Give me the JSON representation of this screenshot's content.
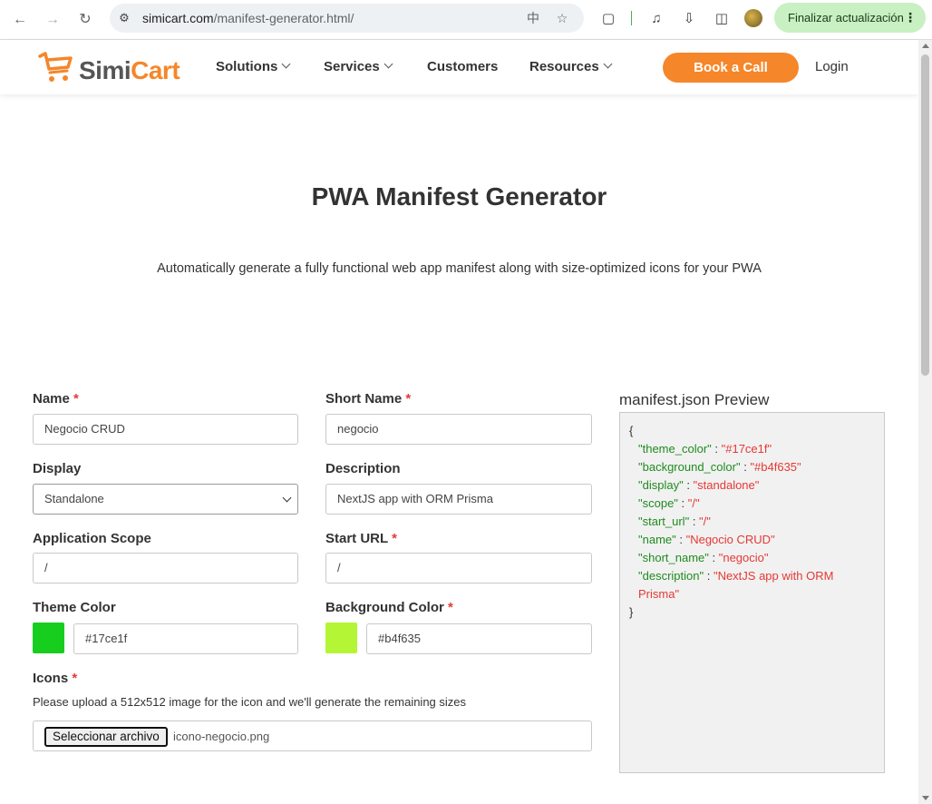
{
  "browser": {
    "url_host": "simicart.com",
    "url_path": "/manifest-generator.html/",
    "update_label": "Finalizar actualización"
  },
  "site": {
    "logo_simi": "Simi",
    "logo_cart": "Cart",
    "nav": [
      "Solutions",
      "Services",
      "Customers",
      "Resources"
    ],
    "cta": "Book a Call",
    "login": "Login"
  },
  "hero": {
    "title": "PWA Manifest Generator",
    "subtitle": "Automatically generate a fully functional web app manifest along with size-optimized icons for your PWA"
  },
  "form": {
    "name": {
      "label": "Name",
      "required": "*",
      "value": "Negocio CRUD"
    },
    "short_name": {
      "label": "Short Name",
      "required": "*",
      "value": "negocio"
    },
    "display": {
      "label": "Display",
      "value": "Standalone"
    },
    "description": {
      "label": "Description",
      "value": "NextJS app with ORM Prisma"
    },
    "scope": {
      "label": "Application Scope",
      "value": "/"
    },
    "start_url": {
      "label": "Start URL",
      "required": "*",
      "value": "/"
    },
    "theme_color": {
      "label": "Theme Color",
      "value": "#17ce1f"
    },
    "background_color": {
      "label": "Background Color",
      "required": "*",
      "value": "#b4f635"
    },
    "icons": {
      "label": "Icons",
      "required": "*",
      "help": "Please upload a 512x512 image for the icon and we'll generate the remaining sizes",
      "button": "Seleccionar archivo",
      "file": "icono-negocio.png"
    }
  },
  "preview": {
    "title": "manifest.json Preview",
    "open": "{",
    "close": "}",
    "entries": [
      {
        "key": "\"theme_color\"",
        "value": "\"#17ce1f\""
      },
      {
        "key": "\"background_color\"",
        "value": "\"#b4f635\""
      },
      {
        "key": "\"display\"",
        "value": "\"standalone\""
      },
      {
        "key": "\"scope\"",
        "value": "\"/\""
      },
      {
        "key": "\"start_url\"",
        "value": "\"/\""
      },
      {
        "key": "\"name\"",
        "value": "\"Negocio CRUD\""
      },
      {
        "key": "\"short_name\"",
        "value": "\"negocio\""
      },
      {
        "key": "\"description\"",
        "value": "\"NextJS app with ORM Prisma\""
      }
    ]
  },
  "colors": {
    "brand": "#f5862a",
    "theme_swatch": "#17ce1f",
    "background_swatch": "#b4f635",
    "json_key": "#1e8c1e",
    "json_value": "#e53935"
  }
}
